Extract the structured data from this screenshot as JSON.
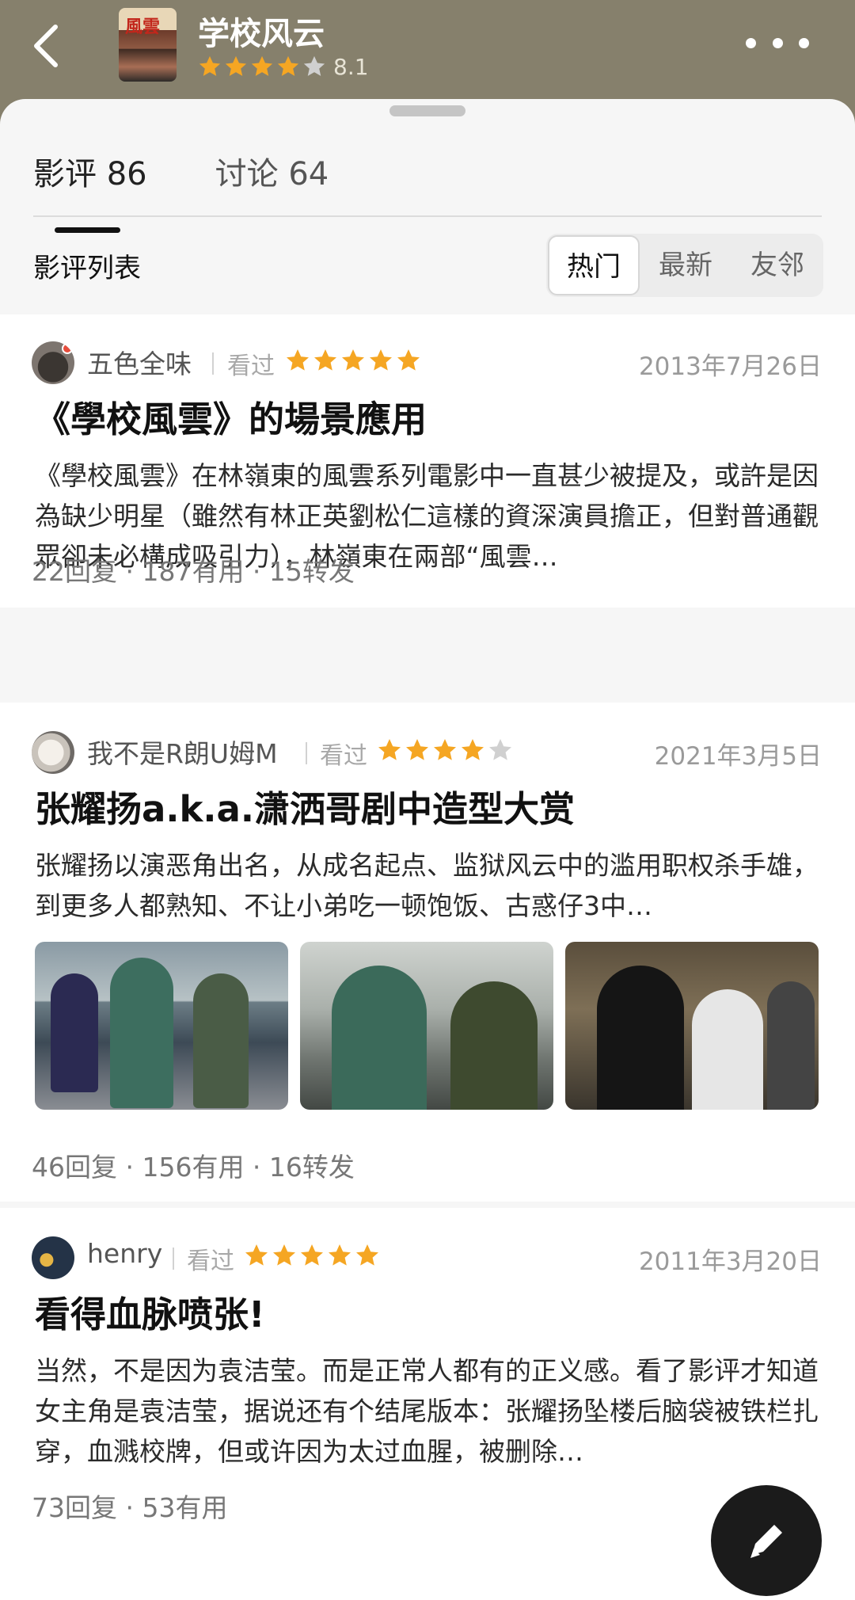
{
  "header": {
    "poster_text": "風雲",
    "title": "学校风云",
    "rating": "8.1",
    "rating_stars": 4
  },
  "tabs": [
    {
      "label": "影评 86"
    },
    {
      "label": "讨论 64"
    }
  ],
  "list": {
    "label": "影评列表",
    "sort_options": [
      "热门",
      "最新",
      "友邻"
    ],
    "selected": "热门"
  },
  "reviews": [
    {
      "author": "五色全味",
      "status": "看过",
      "stars": 5,
      "date": "2013年7月26日",
      "title": "《學校風雲》的場景應用",
      "excerpt": "《學校風雲》在林嶺東的風雲系列電影中一直甚少被提及，或許是因為缺少明星（雖然有林正英劉松仁這樣的資深演員擔正，但對普通觀眾卻未必構成吸引力），林嶺東在兩部“風雲…",
      "stats": "22回复 · 187有用 · 15转发"
    },
    {
      "author": "我不是R朗U姆M",
      "status": "看过",
      "stars": 4,
      "date": "2021年3月5日",
      "title": "张耀扬a.k.a.潇洒哥剧中造型大赏",
      "excerpt": "张耀扬以演恶角出名，从成名起点、监狱风云中的滥用职权杀手雄，到更多人都熟知、不让小弟吃一顿饱饭、古惑仔3中…",
      "stats": "46回复 · 156有用 · 16转发"
    },
    {
      "author": "henry",
      "status": "看过",
      "stars": 5,
      "date": "2011年3月20日",
      "title": "看得血脉喷张!",
      "excerpt": "当然，不是因为袁洁莹。而是正常人都有的正义感。看了影评才知道女主角是袁洁莹，据说还有个结尾版本：张耀扬坠楼后脑袋被铁栏扎穿，血溅校牌，但或许因为太过血腥，被删除…",
      "stats": "73回复 · 53有用"
    }
  ],
  "colors": {
    "header_bg": "#86806c",
    "star": "#f5a623",
    "star_empty": "#d0d0d0"
  },
  "icons": [
    "back-arrow-icon",
    "more-dots-icon",
    "star-icon",
    "pencil-icon"
  ]
}
